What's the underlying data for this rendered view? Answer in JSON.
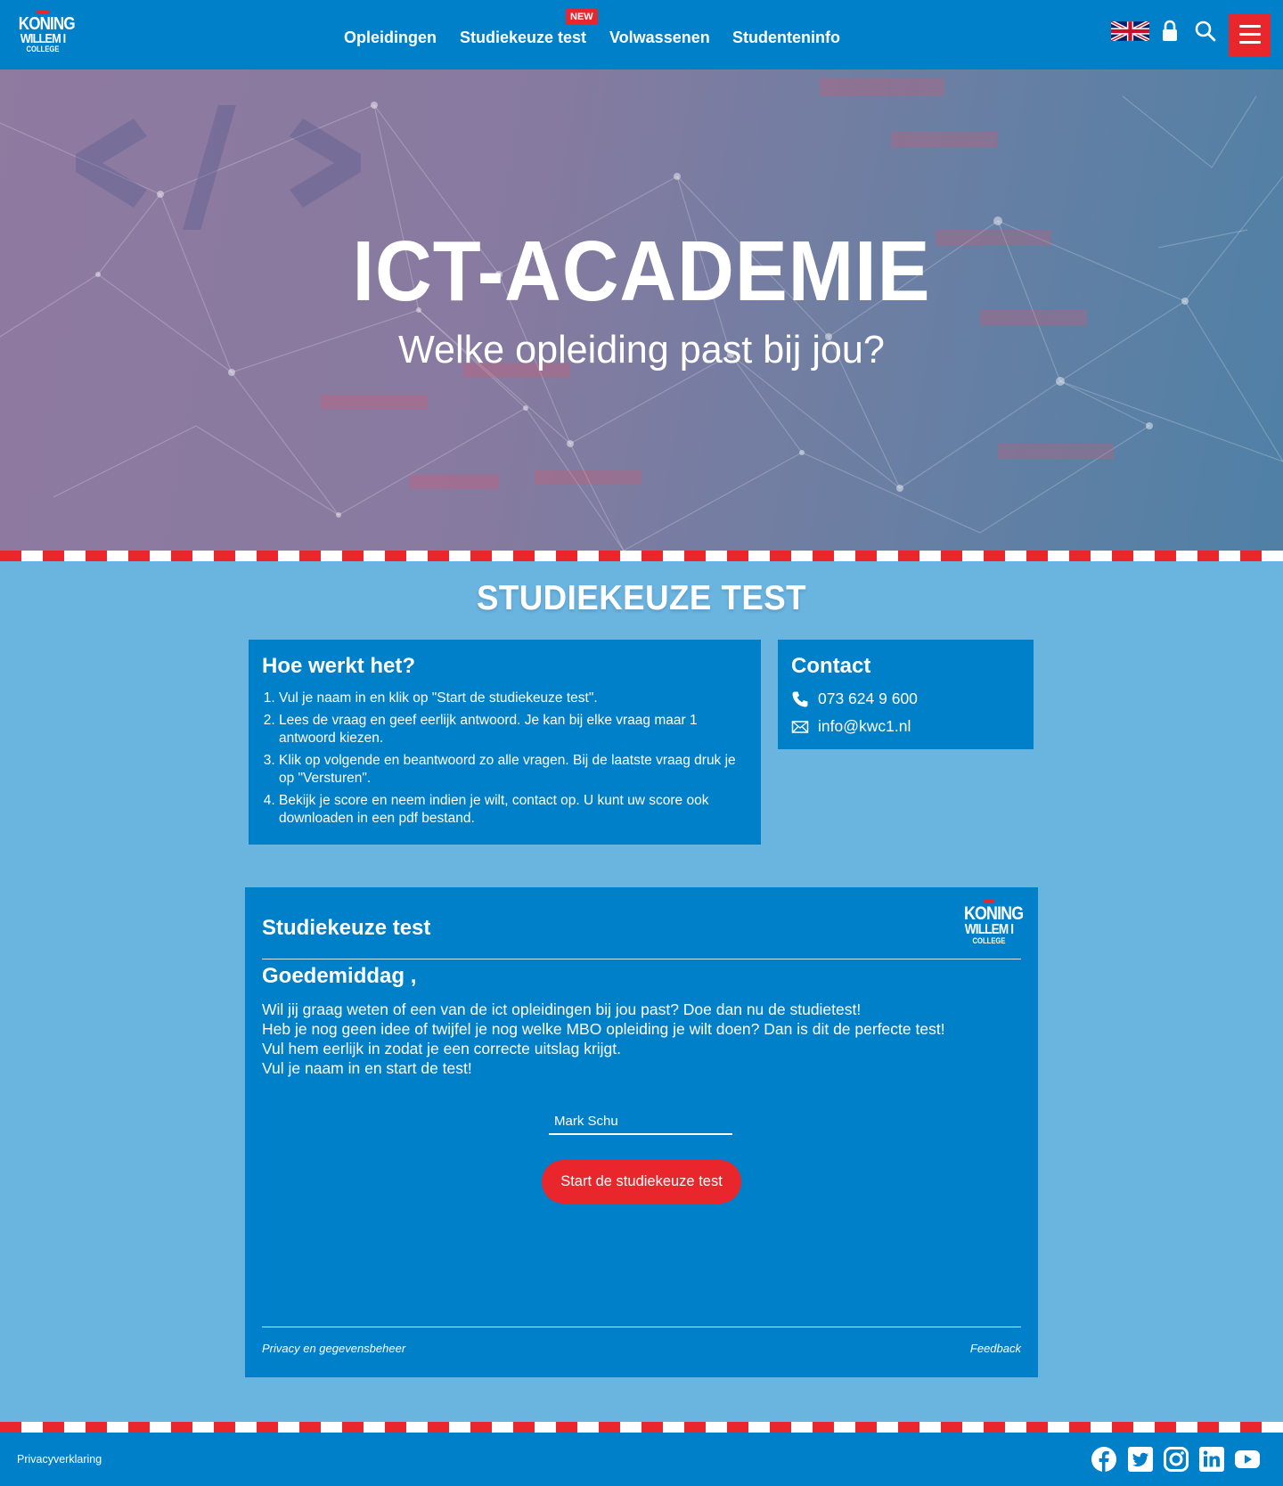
{
  "header": {
    "logo": {
      "line1": "KONING",
      "line2": "WILLEM I",
      "line3": "COLLEGE"
    },
    "nav": [
      {
        "label": "Opleidingen"
      },
      {
        "label": "Studiekeuze test",
        "badge": "NEW"
      },
      {
        "label": "Volwassenen"
      },
      {
        "label": "Studenteninfo"
      }
    ],
    "icons": [
      "uk-flag-icon",
      "lock-icon",
      "search-icon",
      "hamburger-menu-icon"
    ],
    "brand_color": "#0080c8",
    "accent_color": "#e8262b"
  },
  "hero": {
    "title": "ICT-ACADEMIE",
    "subtitle": "Welke opleiding past bij jou?"
  },
  "section": {
    "title": "STUDIEKEUZE TEST"
  },
  "how_it_works": {
    "title": "Hoe werkt het?",
    "steps": [
      "Vul je naam in en klik op \"Start de studiekeuze test\".",
      "Lees de vraag en geef eerlijk antwoord. Je kan bij elke vraag maar 1 antwoord kiezen.",
      "Klik op volgende en beantwoord zo alle vragen. Bij de laatste vraag druk je op \"Versturen\".",
      "Bekijk je score en neem indien je wilt, contact op. U kunt uw score ook downloaden in een pdf bestand."
    ]
  },
  "contact": {
    "title": "Contact",
    "phone": "073 624 9 600",
    "email": "info@kwc1.nl"
  },
  "test": {
    "title": "Studiekeuze test",
    "logo": {
      "line1": "KONING",
      "line2": "WILLEM I",
      "line3": "COLLEGE"
    },
    "greeting": "Goedemiddag ,",
    "intro": [
      "Wil jij graag weten of een van de ict opleidingen bij jou past? Doe dan nu de studietest!",
      "Heb je nog geen idee of twijfel je nog welke MBO opleiding je wilt doen? Dan is dit de perfecte test!",
      "Vul hem eerlijk in zodat je een correcte uitslag krijgt.",
      "Vul je naam in en start de test!"
    ],
    "name_value": "Mark Schu",
    "start_label": "Start de studiekeuze test",
    "footer_left": "Privacy en gegevensbeheer",
    "footer_right": "Feedback"
  },
  "footer": {
    "link": "Privacyverklaring",
    "social": [
      "facebook-icon",
      "twitter-icon",
      "instagram-icon",
      "linkedin-icon",
      "youtube-icon"
    ]
  }
}
